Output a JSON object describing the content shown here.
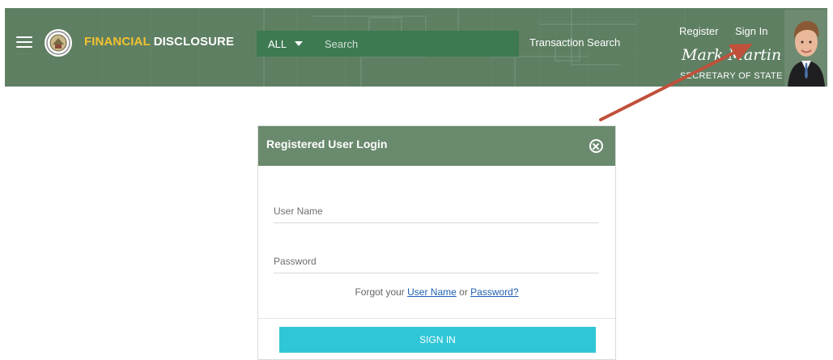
{
  "header": {
    "brand_part1": "FINANCIAL",
    "brand_part2": " DISCLOSURE",
    "search": {
      "scope": "ALL",
      "placeholder": "Search"
    },
    "transaction_search": "Transaction Search",
    "register": "Register",
    "sign_in": "Sign In",
    "signature": "Mark Martin",
    "title": "SECRETARY OF STATE"
  },
  "modal": {
    "title": "Registered User Login",
    "username_placeholder": "User Name",
    "password_placeholder": "Password",
    "forgot_prefix": "Forgot your ",
    "forgot_username": "User Name",
    "forgot_or": " or ",
    "forgot_password": "Password?",
    "submit": "SIGN IN"
  },
  "colors": {
    "header_bg": "#5e7f62",
    "brand_accent": "#f2c230",
    "modal_header": "#6a8a6e",
    "button": "#2fc6d8",
    "arrow": "#c0503a",
    "link": "#1f5fb0"
  },
  "icons": [
    "hamburger-menu-icon",
    "state-seal-icon",
    "chevron-down-icon",
    "close-circle-icon",
    "portrait-photo"
  ]
}
